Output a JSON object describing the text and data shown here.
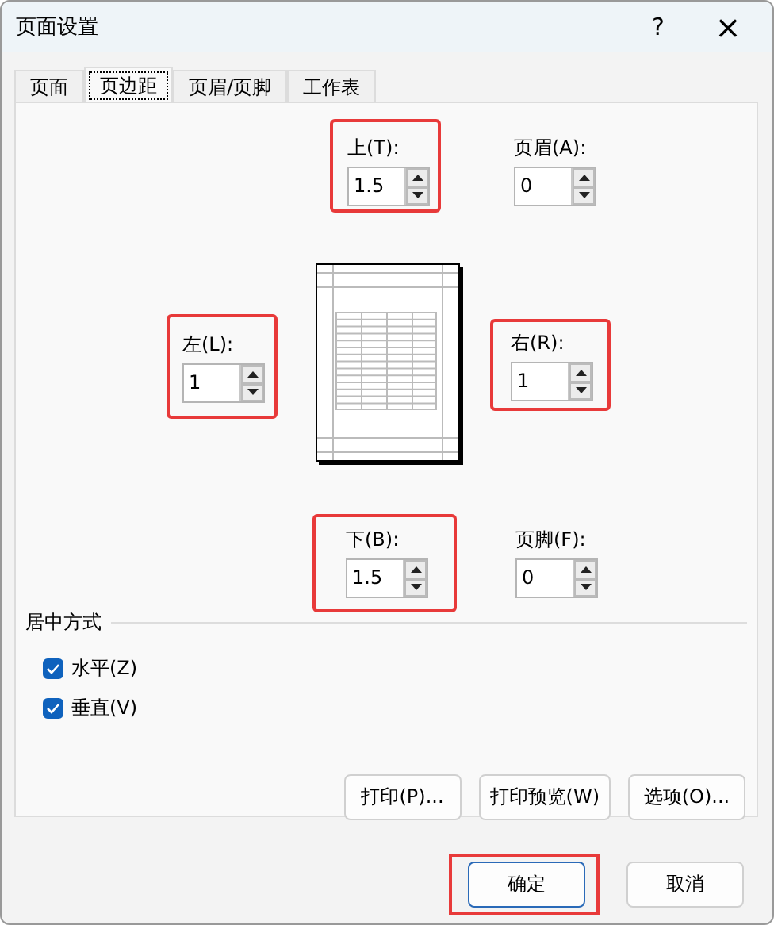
{
  "window": {
    "title": "页面设置",
    "help": "?",
    "close": "×"
  },
  "tabs": [
    {
      "label": "页面",
      "selected": false
    },
    {
      "label": "页边距",
      "selected": true
    },
    {
      "label": "页眉/页脚",
      "selected": false
    },
    {
      "label": "工作表",
      "selected": false
    }
  ],
  "fields": [
    {
      "label": "上(T):",
      "value": "1.5",
      "highlighted": true
    },
    {
      "label": "页眉(A):",
      "value": "0",
      "highlighted": false
    },
    {
      "label": "左(L):",
      "value": "1",
      "highlighted": true
    },
    {
      "label": "右(R):",
      "value": "1",
      "highlighted": true
    },
    {
      "label": "下(B):",
      "value": "1.5",
      "highlighted": true
    },
    {
      "label": "页脚(F):",
      "value": "0",
      "highlighted": false
    }
  ],
  "center": {
    "title": "居中方式",
    "options": [
      {
        "label": "水平(Z)",
        "checked": true
      },
      {
        "label": "垂直(V)",
        "checked": true
      }
    ]
  },
  "tab_buttons": [
    "打印(P)...",
    "打印预览(W)",
    "选项(O)..."
  ],
  "buttons": [
    {
      "label": "确定",
      "highlighted": true
    },
    {
      "label": "取消",
      "highlighted": false
    }
  ]
}
